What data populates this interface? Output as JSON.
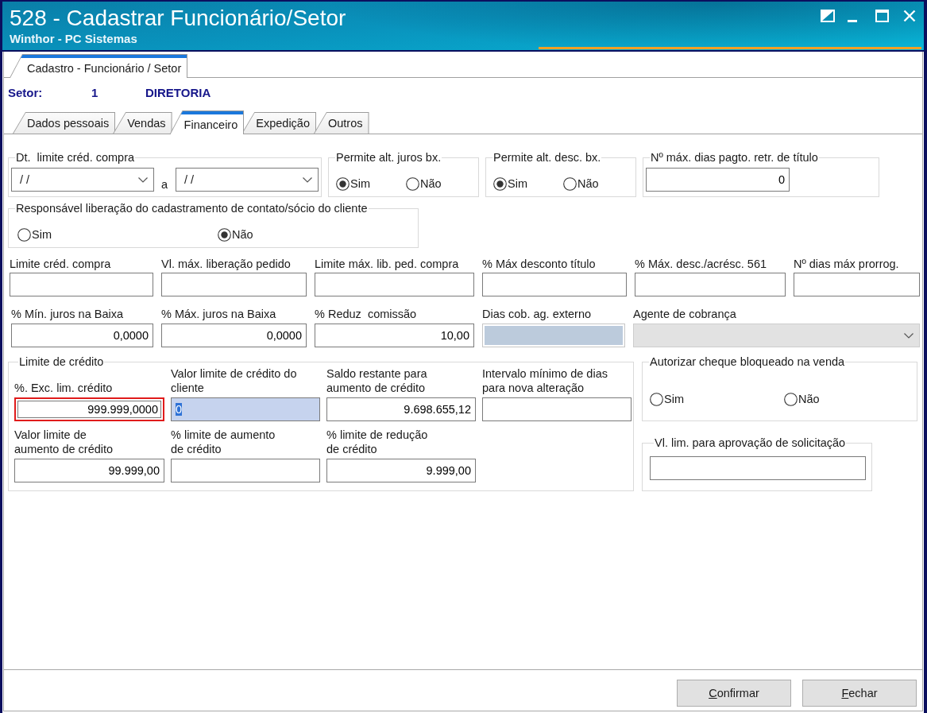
{
  "window": {
    "title": "528 - Cadastrar Funcionário/Setor",
    "subtitle": "Winthor - PC Sistemas"
  },
  "main_tabs": [
    {
      "label": "Cadastro - Funcionário / Setor",
      "selected": true
    }
  ],
  "sector": {
    "label": "Setor:",
    "code": "1",
    "name": "DIRETORIA"
  },
  "tabs": [
    {
      "label": "Dados pessoais",
      "selected": false
    },
    {
      "label": "Vendas",
      "selected": false
    },
    {
      "label": "Financeiro",
      "selected": true
    },
    {
      "label": "Expedição",
      "selected": false
    },
    {
      "label": "Outros",
      "selected": false
    }
  ],
  "purchase_credit_date": {
    "title": "Dt.  limite créd. compra",
    "from": "/ /",
    "connector": "a",
    "to": "/ /"
  },
  "radio_groups": [
    {
      "title": "Permite alt. juros bx.",
      "options": [
        {
          "label": "Sim",
          "selected": true
        },
        {
          "label": "Não",
          "selected": false
        }
      ]
    },
    {
      "title": "Permite alt. desc. bx.",
      "options": [
        {
          "label": "Sim",
          "selected": true
        },
        {
          "label": "Não",
          "selected": false
        }
      ]
    }
  ],
  "max_days": {
    "title": "Nº máx. dias pagto. retr. de título",
    "value": "0"
  },
  "contact_release": {
    "title": "Responsável liberação do cadastramento de contato/sócio do cliente",
    "options": [
      {
        "label": "Sim",
        "selected": false
      },
      {
        "label": "Não",
        "selected": true
      }
    ]
  },
  "fields_row_1": [
    {
      "label": "Limite créd. compra"
    },
    {
      "label": "Vl. máx. liberação pedido"
    },
    {
      "label": "Limite máx. lib. ped. compra"
    },
    {
      "label": "% Máx desconto título"
    },
    {
      "label": "% Máx. desc./acrésc. 561"
    },
    {
      "label": "Nº dias máx prorrog."
    }
  ],
  "fields_row_2": [
    {
      "label": "% Mín. juros na Baixa",
      "value": "0,0000",
      "kind": "text",
      "disabled": false
    },
    {
      "label": "% Máx. juros na Baixa",
      "value": "0,0000",
      "kind": "text",
      "disabled": false
    },
    {
      "label": "% Reduz  comissão",
      "value": "10,00",
      "kind": "text",
      "disabled": false
    },
    {
      "label": "Dias cob. ag. externo",
      "kind": "text",
      "disabled": true
    },
    {
      "label": "Agente de cobrança",
      "kind": "combo",
      "disabled": true
    }
  ],
  "credit_limit": {
    "title": "Limite de crédito",
    "fields": [
      {
        "label": "%. Exc. lim. crédito",
        "value": "999.999,0000",
        "focused": false,
        "highlighted": true
      },
      {
        "label": "Valor limite de crédito do\ncliente",
        "value": "0",
        "focused": true,
        "highlighted": false
      },
      {
        "label": "Saldo restante para\naumento de crédito",
        "value": "9.698.655,12",
        "focused": false,
        "highlighted": false
      },
      {
        "label": "Intervalo mínimo de dias\npara nova alteração",
        "focused": false,
        "highlighted": false
      },
      {
        "label": "Valor limite de\naumento de crédito",
        "value": "99.999,00",
        "focused": false,
        "highlighted": false
      },
      {
        "label": "% limite de aumento\nde crédito",
        "focused": false,
        "highlighted": false
      },
      {
        "label": "% limite de redução\nde crédito",
        "value": "9.999,00",
        "focused": false,
        "highlighted": false
      }
    ]
  },
  "cheque_authorization": {
    "title": "Autorizar cheque bloqueado na venda",
    "options": [
      {
        "label": "Sim",
        "selected": false
      },
      {
        "label": "Não",
        "selected": false
      }
    ]
  },
  "approval_limit": {
    "title": "Vl. lim. para aprovação de solicitação"
  },
  "buttons": [
    {
      "label": "Confirmar"
    },
    {
      "label": "Fechar"
    }
  ]
}
